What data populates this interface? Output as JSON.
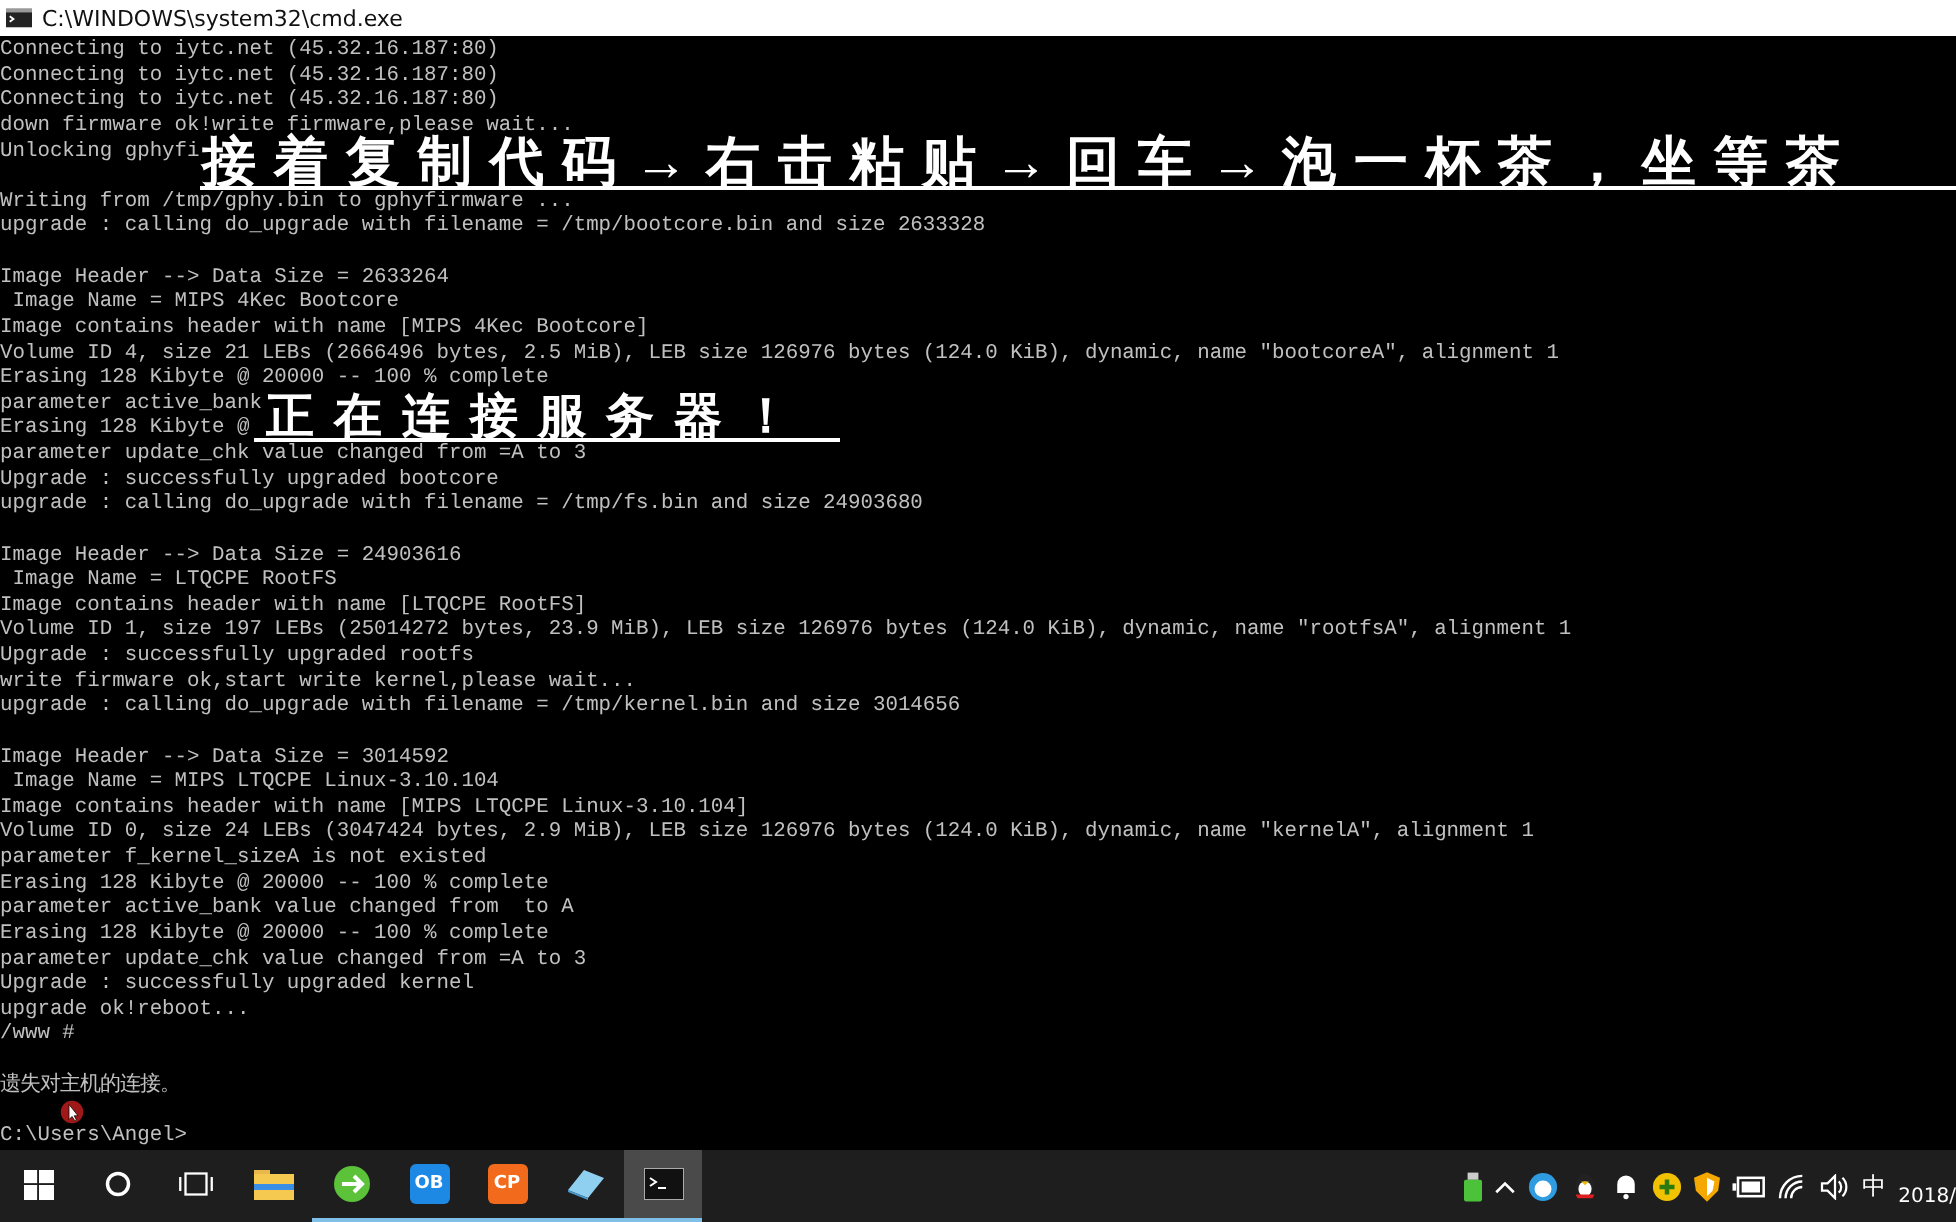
{
  "window": {
    "title": "C:\\WINDOWS\\system32\\cmd.exe"
  },
  "console": {
    "blocks": [
      {
        "lines": [
          "Connecting to iytc.net (45.32.16.187:80)",
          "Connecting to iytc.net (45.32.16.187:80)",
          "Connecting to iytc.net (45.32.16.187:80)",
          "down firmware ok!write firmware,please wait...",
          "Unlocking gphyfi"
        ]
      },
      {
        "lines": [
          "Writing from /tmp/gphy.bin to gphyfirmware ...",
          "upgrade : calling do_upgrade with filename = /tmp/bootcore.bin and size 2633328"
        ]
      },
      {
        "lines": [
          "Image Header --> Data Size = 2633264",
          " Image Name = MIPS 4Kec Bootcore",
          "Image contains header with name [MIPS 4Kec Bootcore]",
          "Volume ID 4, size 21 LEBs (2666496 bytes, 2.5 MiB), LEB size 126976 bytes (124.0 KiB), dynamic, name \"bootcoreA\", alignment 1",
          "Erasing 128 Kibyte @ 20000 -- 100 % complete",
          "parameter active_bank",
          "Erasing 128 Kibyte @",
          "parameter update_chk value changed from =A to 3",
          "Upgrade : successfully upgraded bootcore",
          "upgrade : calling do_upgrade with filename = /tmp/fs.bin and size 24903680"
        ]
      },
      {
        "lines": [
          "Image Header --> Data Size = 24903616",
          " Image Name = LTQCPE RootFS",
          "Image contains header with name [LTQCPE RootFS]",
          "Volume ID 1, size 197 LEBs (25014272 bytes, 23.9 MiB), LEB size 126976 bytes (124.0 KiB), dynamic, name \"rootfsA\", alignment 1",
          "Upgrade : successfully upgraded rootfs",
          "write firmware ok,start write kernel,please wait...",
          "upgrade : calling do_upgrade with filename = /tmp/kernel.bin and size 3014656"
        ]
      },
      {
        "lines": [
          "Image Header --> Data Size = 3014592",
          " Image Name = MIPS LTQCPE Linux-3.10.104",
          "Image contains header with name [MIPS LTQCPE Linux-3.10.104]",
          "Volume ID 0, size 24 LEBs (3047424 bytes, 2.9 MiB), LEB size 126976 bytes (124.0 KiB), dynamic, name \"kernelA\", alignment 1",
          "parameter f_kernel_sizeA is not existed",
          "Erasing 128 Kibyte @ 20000 -- 100 % complete",
          "parameter active_bank value changed from  to A",
          "Erasing 128 Kibyte @ 20000 -- 100 % complete",
          "parameter update_chk value changed from =A to 3",
          "Upgrade : successfully upgraded kernel",
          "upgrade ok!reboot...",
          "/www #"
        ]
      },
      {
        "lines": [
          "遗失对主机的连接。"
        ]
      },
      {
        "lines": [
          "C:\\Users\\Angel>"
        ]
      }
    ]
  },
  "captions": [
    {
      "text": "接着复制代码→右击粘贴→回车→泡一杯茶，坐等茶"
    },
    {
      "text": "正在连接服务器！"
    }
  ],
  "taskbar": {
    "apps": [
      {
        "kind": "start",
        "running": false,
        "selected": false
      },
      {
        "kind": "search",
        "running": false,
        "selected": false
      },
      {
        "kind": "taskview",
        "running": false,
        "selected": false
      },
      {
        "kind": "folder",
        "running": false,
        "selected": false
      },
      {
        "kind": "green",
        "running": true,
        "selected": false
      },
      {
        "kind": "tile",
        "label": "OB",
        "color": "#1e88e5",
        "running": true,
        "selected": false
      },
      {
        "kind": "tile",
        "label": "CP",
        "color": "#f26b1d",
        "running": true,
        "selected": false
      },
      {
        "kind": "diamond",
        "running": true,
        "selected": false
      },
      {
        "kind": "console",
        "running": true,
        "selected": true
      }
    ],
    "tray": [
      {
        "kind": "usb"
      },
      {
        "kind": "caret"
      },
      {
        "kind": "face"
      },
      {
        "kind": "penguin"
      },
      {
        "kind": "bell"
      },
      {
        "kind": "plus"
      },
      {
        "kind": "shield"
      },
      {
        "kind": "battery"
      },
      {
        "kind": "wifi"
      },
      {
        "kind": "speaker"
      },
      {
        "kind": "ime",
        "text": "中"
      }
    ],
    "clock": "2018/"
  }
}
